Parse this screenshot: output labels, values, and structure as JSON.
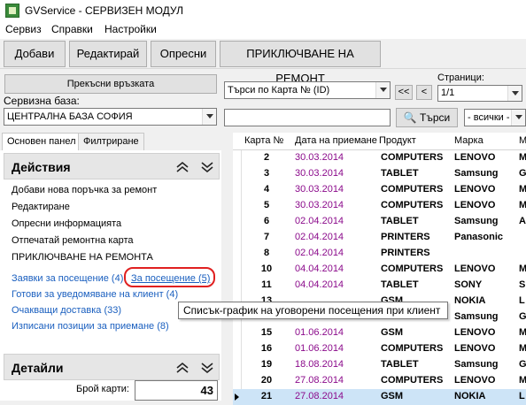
{
  "window": {
    "title": "GVService - СЕРВИЗЕН МОДУЛ"
  },
  "menu": [
    "Сервиз",
    "Справки",
    "Настройки"
  ],
  "toolbar": {
    "add": "Добави",
    "edit": "Редактирай",
    "refresh": "Опресни",
    "finish_repair": "ПРИКЛЮЧВАНЕ НА РЕМОНТ"
  },
  "connection": {
    "disconnect_label": "Прекъсни връзката",
    "service_db_label": "Сервизна база:",
    "service_db_value": "ЦЕНТРАЛНА БАЗА СОФИЯ"
  },
  "search": {
    "mode_value": "Търси по Карта № (ID)",
    "query_value": "",
    "search_label": "Търси",
    "filter_value": "- всички -",
    "pages_label": "Страници:",
    "page_first": "<<",
    "page_prev": "<",
    "page_value": "1/1"
  },
  "left": {
    "tabs": [
      "Основен панел",
      "Филтриране"
    ],
    "actions_title": "Действия",
    "actions": [
      "Добави нова поръчка за ремонт",
      "Редактиране",
      "Опресни информацията",
      "Отпечатай ремонтна карта",
      "ПРИКЛЮЧВАНЕ НА РЕМОНТА"
    ],
    "links": {
      "visit_requests": "Заявки за посещение (4)",
      "for_visit": "За посещение (5)",
      "ready_notify": "Готови за уведомяване на клиент (4)",
      "awaiting_delivery": "Очакващи доставка (33)",
      "written_off": "Изписани позиции за приемане (8)"
    },
    "details_title": "Детайли",
    "cards_count_label": "Брой карти:",
    "cards_count_value": "43"
  },
  "tooltip": "Списък-график на уговорени посещения при клиент",
  "grid": {
    "headers": [
      "Карта №",
      "Дата на приемане",
      "Продукт",
      "Марка",
      "М"
    ],
    "rows": [
      [
        "2",
        "30.03.2014",
        "COMPUTERS",
        "LENOVO",
        "M"
      ],
      [
        "3",
        "30.03.2014",
        "TABLET",
        "Samsung",
        "G"
      ],
      [
        "4",
        "30.03.2014",
        "COMPUTERS",
        "LENOVO",
        "M"
      ],
      [
        "5",
        "30.03.2014",
        "COMPUTERS",
        "LENOVO",
        "M"
      ],
      [
        "6",
        "02.04.2014",
        "TABLET",
        "Samsung",
        "A"
      ],
      [
        "7",
        "02.04.2014",
        "PRINTERS",
        "Panasonic",
        ""
      ],
      [
        "8",
        "02.04.2014",
        "PRINTERS",
        "",
        ""
      ],
      [
        "10",
        "04.04.2014",
        "COMPUTERS",
        "LENOVO",
        "M"
      ],
      [
        "11",
        "04.04.2014",
        "TABLET",
        "SONY",
        "S"
      ],
      [
        "13",
        "",
        "GSM",
        "NOKIA",
        "L"
      ],
      [
        "14",
        "",
        "",
        "Samsung",
        "G"
      ],
      [
        "15",
        "01.06.2014",
        "GSM",
        "LENOVO",
        "M"
      ],
      [
        "16",
        "01.06.2014",
        "COMPUTERS",
        "LENOVO",
        "M"
      ],
      [
        "19",
        "18.08.2014",
        "TABLET",
        "Samsung",
        "G"
      ],
      [
        "20",
        "27.08.2014",
        "COMPUTERS",
        "LENOVO",
        "M"
      ],
      [
        "21",
        "27.08.2014",
        "GSM",
        "NOKIA",
        "L"
      ]
    ]
  }
}
